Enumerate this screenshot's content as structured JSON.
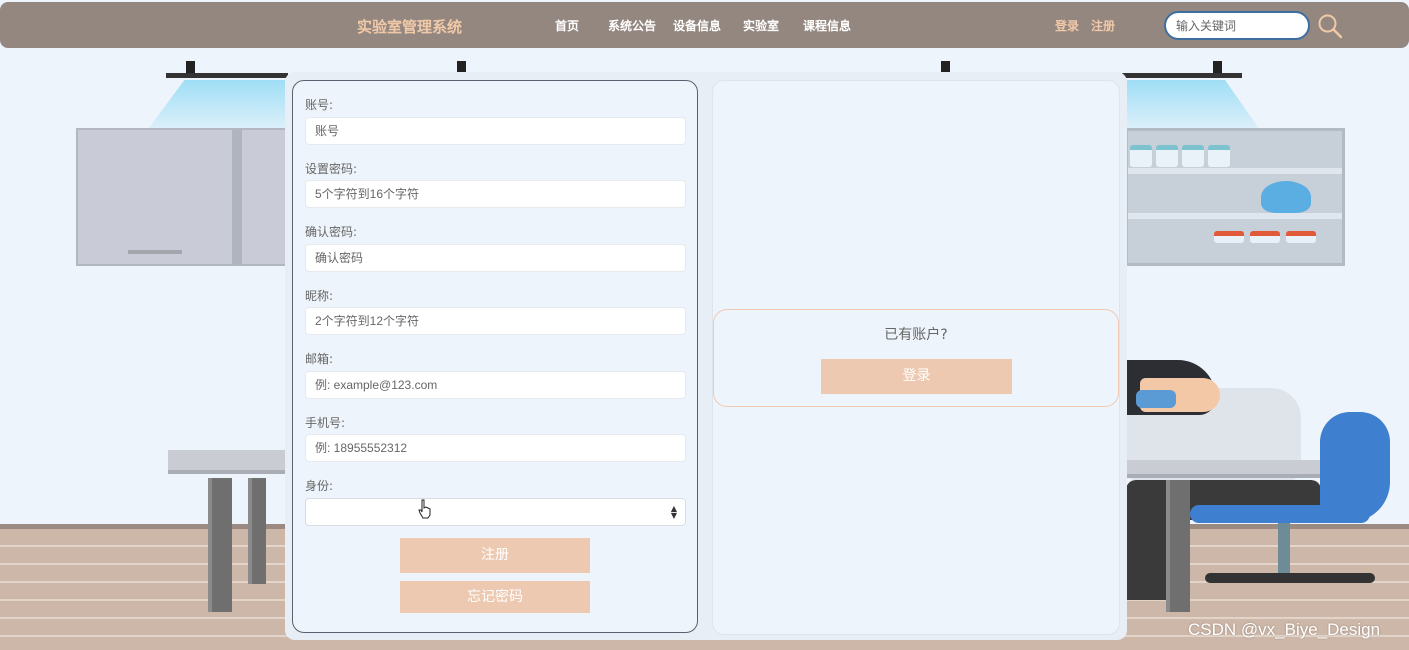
{
  "header": {
    "brand": "实验室管理系统",
    "nav": [
      {
        "label": "首页"
      },
      {
        "label": "系统公告"
      },
      {
        "label": "设备信息"
      },
      {
        "label": "实验室"
      },
      {
        "label": "课程信息"
      }
    ],
    "login_label": "登录",
    "register_label": "注册",
    "search_placeholder": "输入关键词",
    "search_value": "",
    "search_icon": "magnifier-icon"
  },
  "register_form": {
    "fields": [
      {
        "label": "账号:",
        "placeholder": "账号",
        "value": ""
      },
      {
        "label": "设置密码:",
        "placeholder": "5个字符到16个字符",
        "value": ""
      },
      {
        "label": "确认密码:",
        "placeholder": "确认密码",
        "value": ""
      },
      {
        "label": "昵称:",
        "placeholder": "2个字符到12个字符",
        "value": ""
      },
      {
        "label": "邮箱:",
        "placeholder": "例: example@123.com",
        "value": ""
      },
      {
        "label": "手机号:",
        "placeholder": "例: 18955552312",
        "value": ""
      }
    ],
    "role": {
      "label": "身份:",
      "selected": ""
    },
    "submit_label": "注册",
    "forgot_label": "忘记密码"
  },
  "login_side": {
    "prompt": "已有账户?",
    "login_label": "登录"
  },
  "watermark": "CSDN @vx_Biye_Design",
  "colors": {
    "nav_bg": "#948780",
    "brand_text": "#f0c9a8",
    "button_bg": "#edc9b1",
    "panel_bg": "#eef4fb",
    "search_border": "#3d6ea0"
  }
}
